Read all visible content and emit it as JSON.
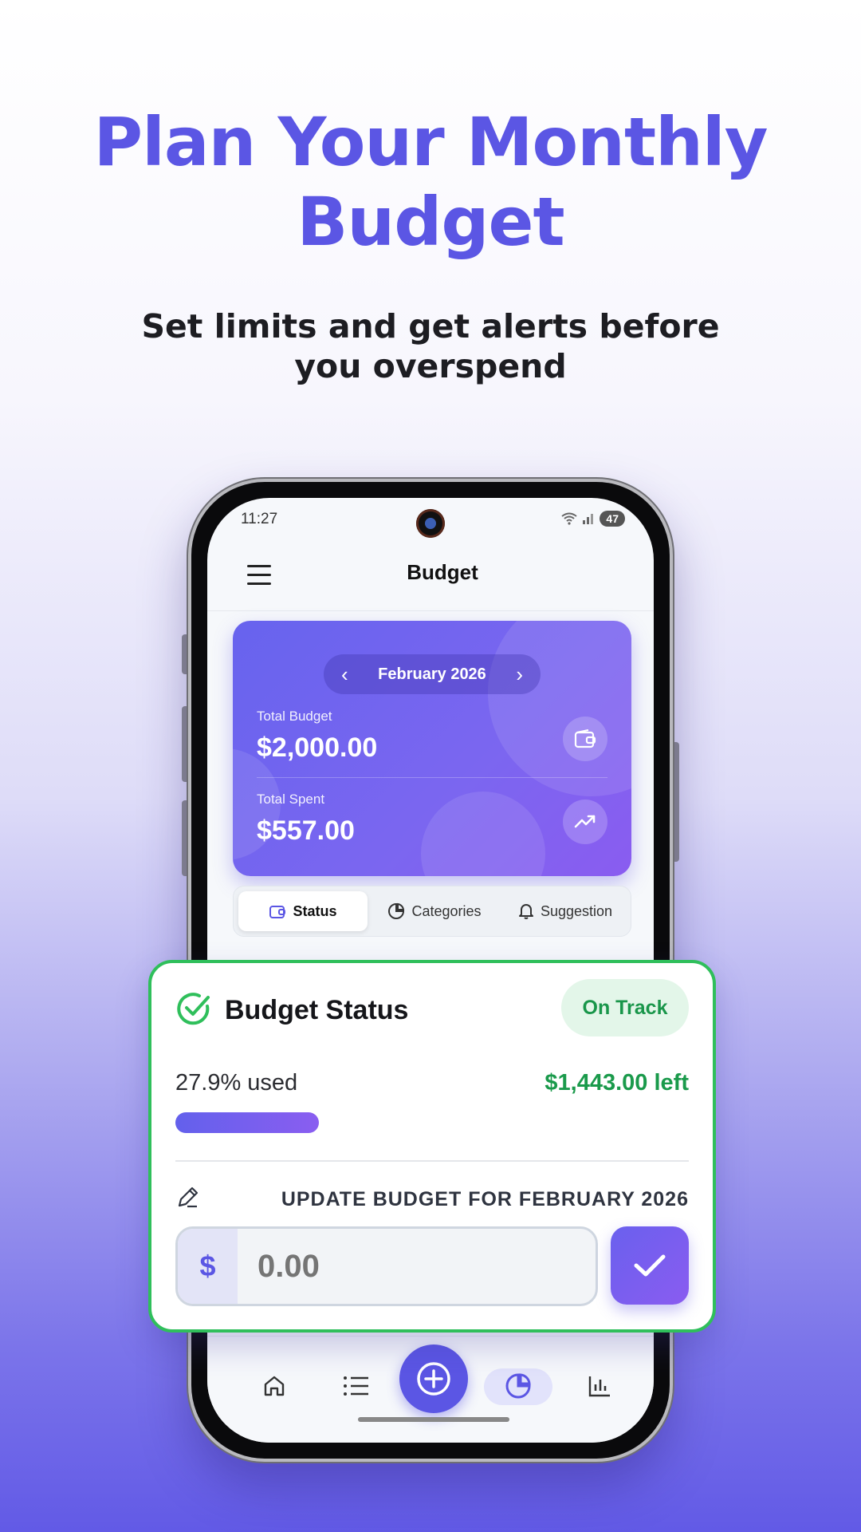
{
  "hero": {
    "title_line1": "Plan Your Monthly",
    "title_line2": "Budget",
    "subtitle_line1": "Set limits and get alerts before",
    "subtitle_line2": "you overspend"
  },
  "status_bar": {
    "time": "11:27",
    "battery": "47"
  },
  "header": {
    "title": "Budget"
  },
  "summary": {
    "month": "February 2026",
    "total_budget_label": "Total Budget",
    "total_budget_value": "$2,000.00",
    "total_spent_label": "Total Spent",
    "total_spent_value": "$557.00"
  },
  "tabs": [
    {
      "label": "Status",
      "icon": "wallet-icon",
      "active": true
    },
    {
      "label": "Categories",
      "icon": "pie-chart-icon",
      "active": false
    },
    {
      "label": "Suggestion",
      "icon": "bell-icon",
      "active": false
    }
  ],
  "status_card": {
    "title": "Budget Status",
    "badge": "On Track",
    "used_text": "27.9% used",
    "used_fraction": 0.279,
    "left_text": "$1,443.00 left",
    "update_label": "UPDATE BUDGET FOR FEBRUARY 2026",
    "currency_symbol": "$",
    "amount_placeholder": "0.00"
  },
  "bottom_nav": [
    "home-icon",
    "list-icon",
    "add-icon",
    "budget-pie-icon",
    "stats-icon"
  ],
  "colors": {
    "primary": "#5b56e4",
    "success": "#2fbf5b",
    "success_text": "#1a9a4b",
    "badge_bg": "#e3f6e9"
  }
}
